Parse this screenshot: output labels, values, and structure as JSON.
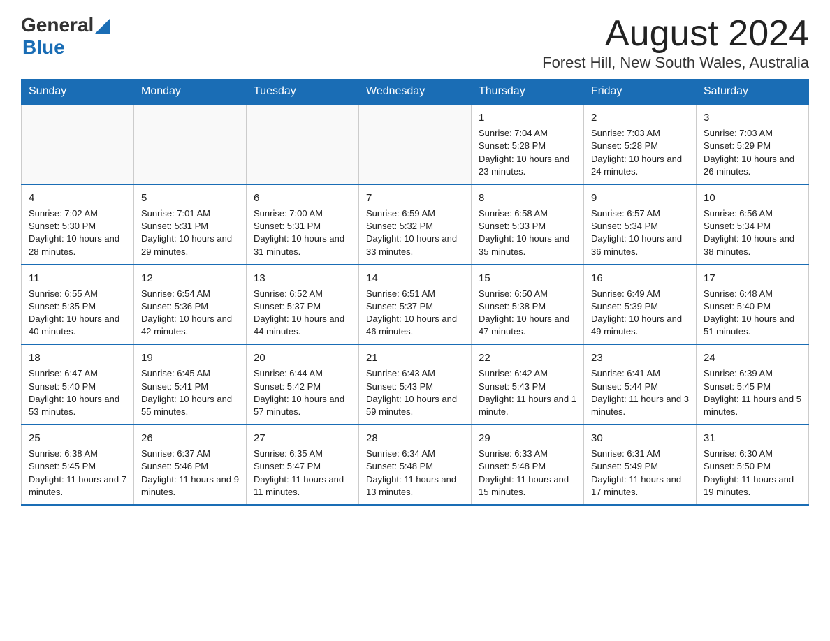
{
  "header": {
    "logo_general": "General",
    "logo_blue": "Blue",
    "month_title": "August 2024",
    "location": "Forest Hill, New South Wales, Australia"
  },
  "days_of_week": [
    "Sunday",
    "Monday",
    "Tuesday",
    "Wednesday",
    "Thursday",
    "Friday",
    "Saturday"
  ],
  "weeks": [
    [
      {
        "day": "",
        "info": ""
      },
      {
        "day": "",
        "info": ""
      },
      {
        "day": "",
        "info": ""
      },
      {
        "day": "",
        "info": ""
      },
      {
        "day": "1",
        "info": "Sunrise: 7:04 AM\nSunset: 5:28 PM\nDaylight: 10 hours and 23 minutes."
      },
      {
        "day": "2",
        "info": "Sunrise: 7:03 AM\nSunset: 5:28 PM\nDaylight: 10 hours and 24 minutes."
      },
      {
        "day": "3",
        "info": "Sunrise: 7:03 AM\nSunset: 5:29 PM\nDaylight: 10 hours and 26 minutes."
      }
    ],
    [
      {
        "day": "4",
        "info": "Sunrise: 7:02 AM\nSunset: 5:30 PM\nDaylight: 10 hours and 28 minutes."
      },
      {
        "day": "5",
        "info": "Sunrise: 7:01 AM\nSunset: 5:31 PM\nDaylight: 10 hours and 29 minutes."
      },
      {
        "day": "6",
        "info": "Sunrise: 7:00 AM\nSunset: 5:31 PM\nDaylight: 10 hours and 31 minutes."
      },
      {
        "day": "7",
        "info": "Sunrise: 6:59 AM\nSunset: 5:32 PM\nDaylight: 10 hours and 33 minutes."
      },
      {
        "day": "8",
        "info": "Sunrise: 6:58 AM\nSunset: 5:33 PM\nDaylight: 10 hours and 35 minutes."
      },
      {
        "day": "9",
        "info": "Sunrise: 6:57 AM\nSunset: 5:34 PM\nDaylight: 10 hours and 36 minutes."
      },
      {
        "day": "10",
        "info": "Sunrise: 6:56 AM\nSunset: 5:34 PM\nDaylight: 10 hours and 38 minutes."
      }
    ],
    [
      {
        "day": "11",
        "info": "Sunrise: 6:55 AM\nSunset: 5:35 PM\nDaylight: 10 hours and 40 minutes."
      },
      {
        "day": "12",
        "info": "Sunrise: 6:54 AM\nSunset: 5:36 PM\nDaylight: 10 hours and 42 minutes."
      },
      {
        "day": "13",
        "info": "Sunrise: 6:52 AM\nSunset: 5:37 PM\nDaylight: 10 hours and 44 minutes."
      },
      {
        "day": "14",
        "info": "Sunrise: 6:51 AM\nSunset: 5:37 PM\nDaylight: 10 hours and 46 minutes."
      },
      {
        "day": "15",
        "info": "Sunrise: 6:50 AM\nSunset: 5:38 PM\nDaylight: 10 hours and 47 minutes."
      },
      {
        "day": "16",
        "info": "Sunrise: 6:49 AM\nSunset: 5:39 PM\nDaylight: 10 hours and 49 minutes."
      },
      {
        "day": "17",
        "info": "Sunrise: 6:48 AM\nSunset: 5:40 PM\nDaylight: 10 hours and 51 minutes."
      }
    ],
    [
      {
        "day": "18",
        "info": "Sunrise: 6:47 AM\nSunset: 5:40 PM\nDaylight: 10 hours and 53 minutes."
      },
      {
        "day": "19",
        "info": "Sunrise: 6:45 AM\nSunset: 5:41 PM\nDaylight: 10 hours and 55 minutes."
      },
      {
        "day": "20",
        "info": "Sunrise: 6:44 AM\nSunset: 5:42 PM\nDaylight: 10 hours and 57 minutes."
      },
      {
        "day": "21",
        "info": "Sunrise: 6:43 AM\nSunset: 5:43 PM\nDaylight: 10 hours and 59 minutes."
      },
      {
        "day": "22",
        "info": "Sunrise: 6:42 AM\nSunset: 5:43 PM\nDaylight: 11 hours and 1 minute."
      },
      {
        "day": "23",
        "info": "Sunrise: 6:41 AM\nSunset: 5:44 PM\nDaylight: 11 hours and 3 minutes."
      },
      {
        "day": "24",
        "info": "Sunrise: 6:39 AM\nSunset: 5:45 PM\nDaylight: 11 hours and 5 minutes."
      }
    ],
    [
      {
        "day": "25",
        "info": "Sunrise: 6:38 AM\nSunset: 5:45 PM\nDaylight: 11 hours and 7 minutes."
      },
      {
        "day": "26",
        "info": "Sunrise: 6:37 AM\nSunset: 5:46 PM\nDaylight: 11 hours and 9 minutes."
      },
      {
        "day": "27",
        "info": "Sunrise: 6:35 AM\nSunset: 5:47 PM\nDaylight: 11 hours and 11 minutes."
      },
      {
        "day": "28",
        "info": "Sunrise: 6:34 AM\nSunset: 5:48 PM\nDaylight: 11 hours and 13 minutes."
      },
      {
        "day": "29",
        "info": "Sunrise: 6:33 AM\nSunset: 5:48 PM\nDaylight: 11 hours and 15 minutes."
      },
      {
        "day": "30",
        "info": "Sunrise: 6:31 AM\nSunset: 5:49 PM\nDaylight: 11 hours and 17 minutes."
      },
      {
        "day": "31",
        "info": "Sunrise: 6:30 AM\nSunset: 5:50 PM\nDaylight: 11 hours and 19 minutes."
      }
    ]
  ]
}
